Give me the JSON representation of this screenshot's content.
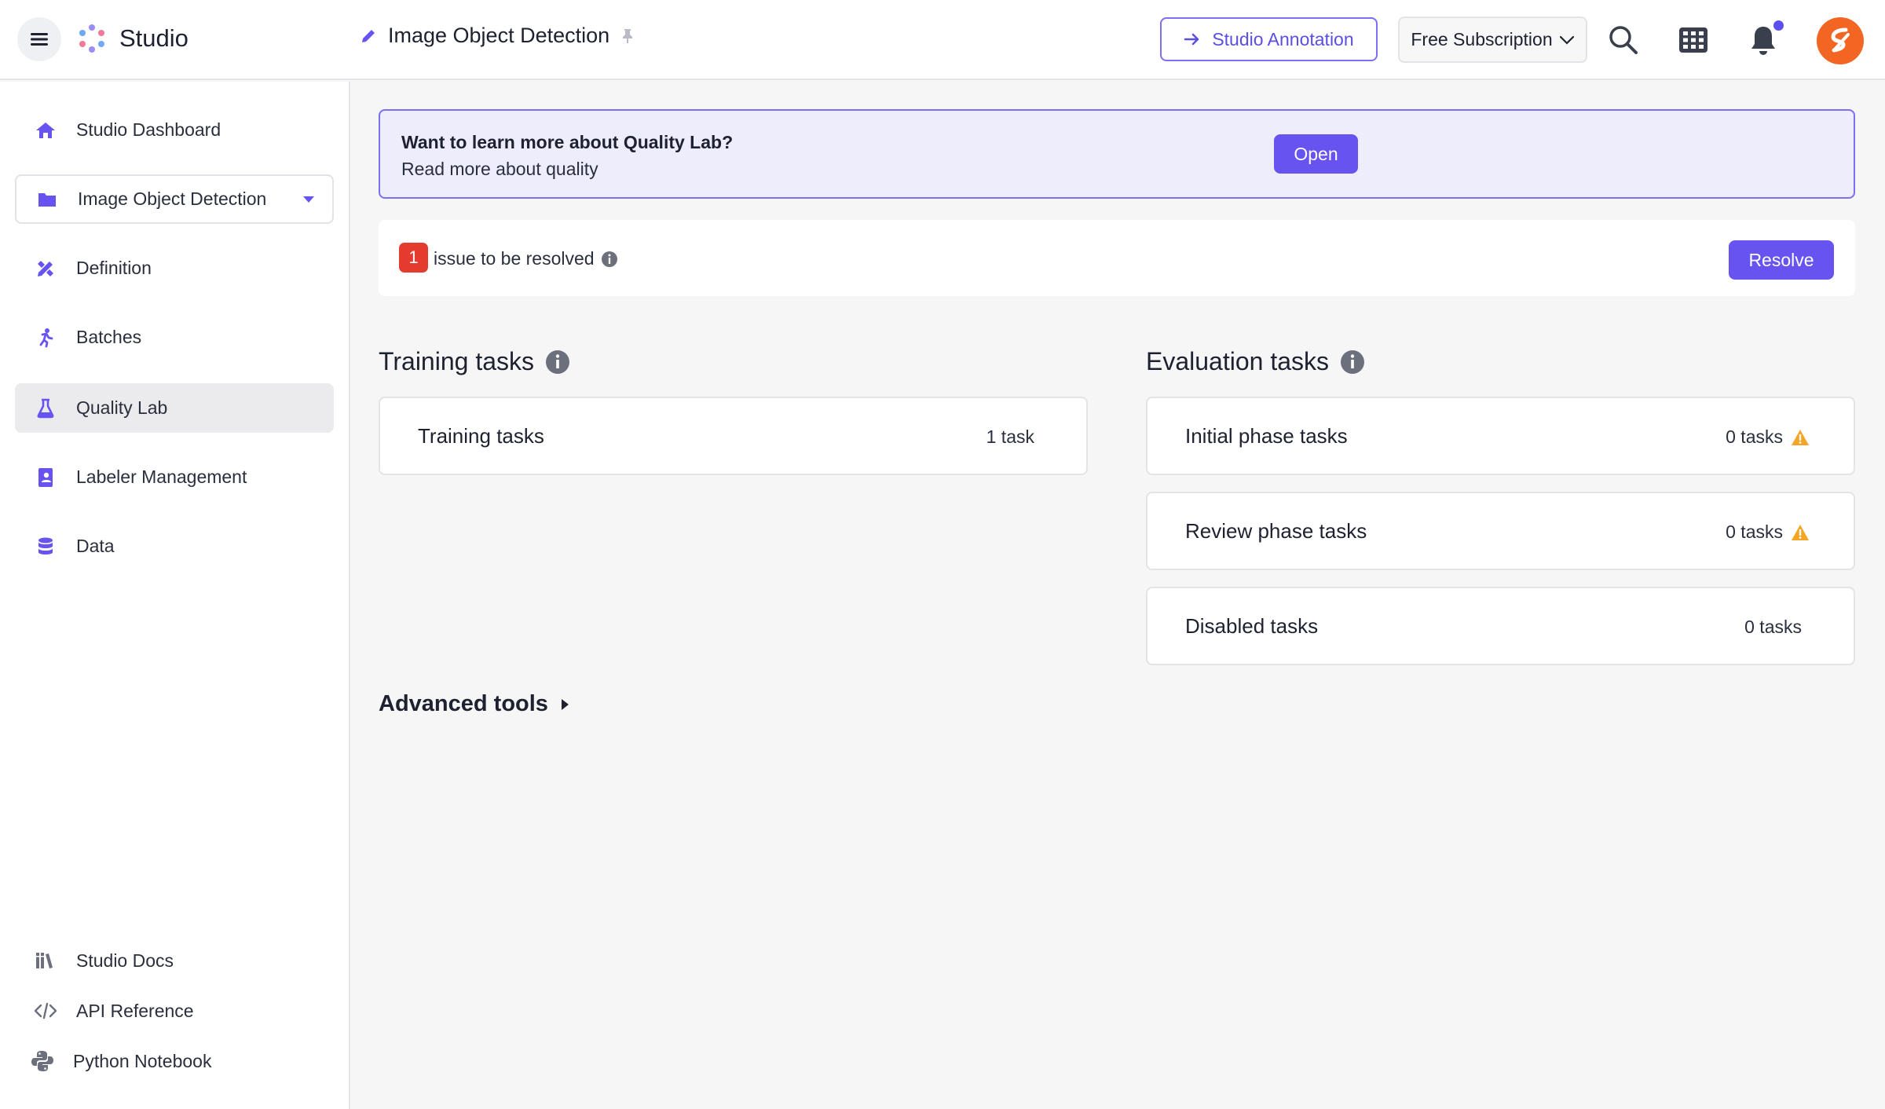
{
  "header": {
    "app_name": "Studio",
    "project_title": "Image Object Detection",
    "annotation_button": "Studio Annotation",
    "subscription": "Free Subscription",
    "accent": "#6653f0"
  },
  "sidebar": {
    "items": [
      {
        "label": "Studio Dashboard",
        "icon": "home-icon"
      },
      {
        "label": "Image Object Detection",
        "icon": "folder-icon"
      },
      {
        "label": "Definition",
        "icon": "pencil-ruler-icon"
      },
      {
        "label": "Batches",
        "icon": "running-icon"
      },
      {
        "label": "Quality Lab",
        "icon": "flask-icon"
      },
      {
        "label": "Labeler Management",
        "icon": "contact-book-icon"
      },
      {
        "label": "Data",
        "icon": "database-icon"
      }
    ],
    "footer": [
      {
        "label": "Studio Docs",
        "icon": "books-icon"
      },
      {
        "label": "API Reference",
        "icon": "code-icon"
      },
      {
        "label": "Python Notebook",
        "icon": "python-icon"
      }
    ]
  },
  "banner": {
    "title": "Want to learn more about Quality Lab?",
    "subtitle": "Read more about quality",
    "button": "Open"
  },
  "issues": {
    "count": "1",
    "text": "issue to be resolved",
    "button": "Resolve",
    "badge_color": "#e33b2e"
  },
  "training": {
    "title": "Training tasks",
    "cards": [
      {
        "label": "Training tasks",
        "count": "1 task"
      }
    ]
  },
  "evaluation": {
    "title": "Evaluation tasks",
    "cards": [
      {
        "label": "Initial phase tasks",
        "count": "0 tasks",
        "warning": true
      },
      {
        "label": "Review phase tasks",
        "count": "0 tasks",
        "warning": true
      },
      {
        "label": "Disabled tasks",
        "count": "0 tasks",
        "warning": false
      }
    ]
  },
  "advanced": {
    "label": "Advanced tools"
  }
}
